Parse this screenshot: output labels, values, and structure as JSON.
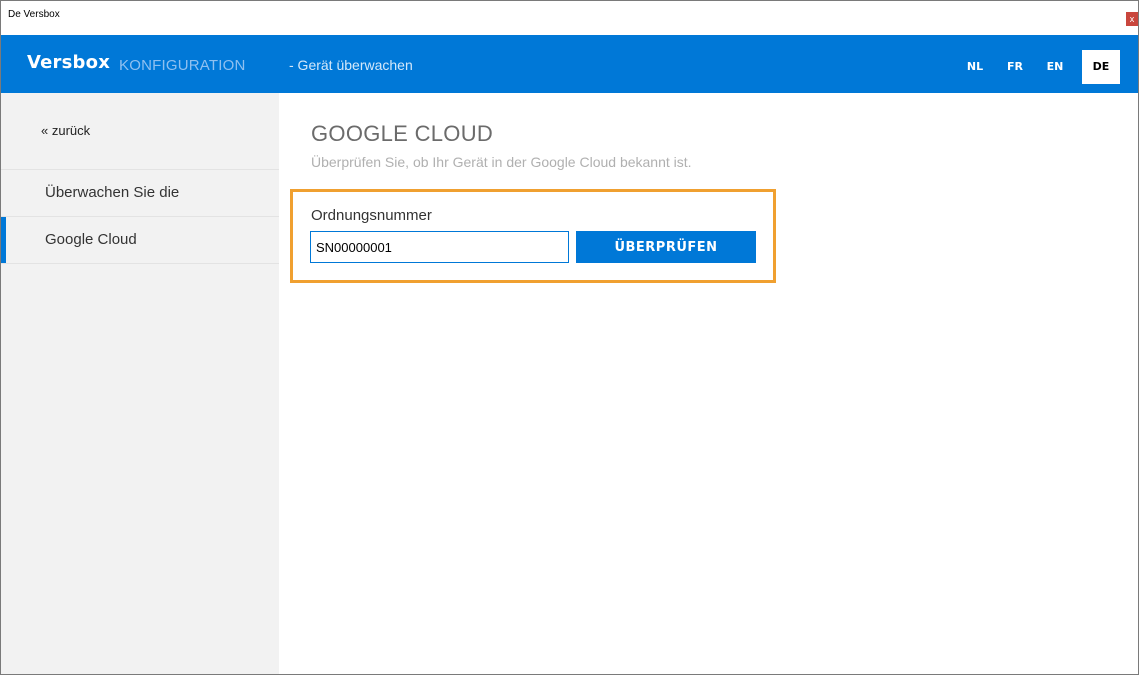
{
  "window": {
    "title": "De Versbox",
    "close_glyph": "x"
  },
  "header": {
    "brand": "Versbox",
    "brand_sub": "KONFIGURATION",
    "page": "- Gerät überwachen",
    "languages": [
      "NL",
      "FR",
      "EN",
      "DE"
    ],
    "active_language": "DE",
    "accent_color": "#0078d7"
  },
  "sidebar": {
    "back_label": "« zurück",
    "items": [
      {
        "label": "Überwachen Sie die"
      },
      {
        "label": "Google Cloud"
      }
    ]
  },
  "main": {
    "title": "GOOGLE CLOUD",
    "description": "Überprüfen Sie, ob Ihr Gerät in der Google Cloud bekannt ist.",
    "field_label": "Ordnungsnummer",
    "serial_value": "SN00000001",
    "button_label": "ÜBERPRÜFEN",
    "highlight_color": "#f0a030"
  }
}
